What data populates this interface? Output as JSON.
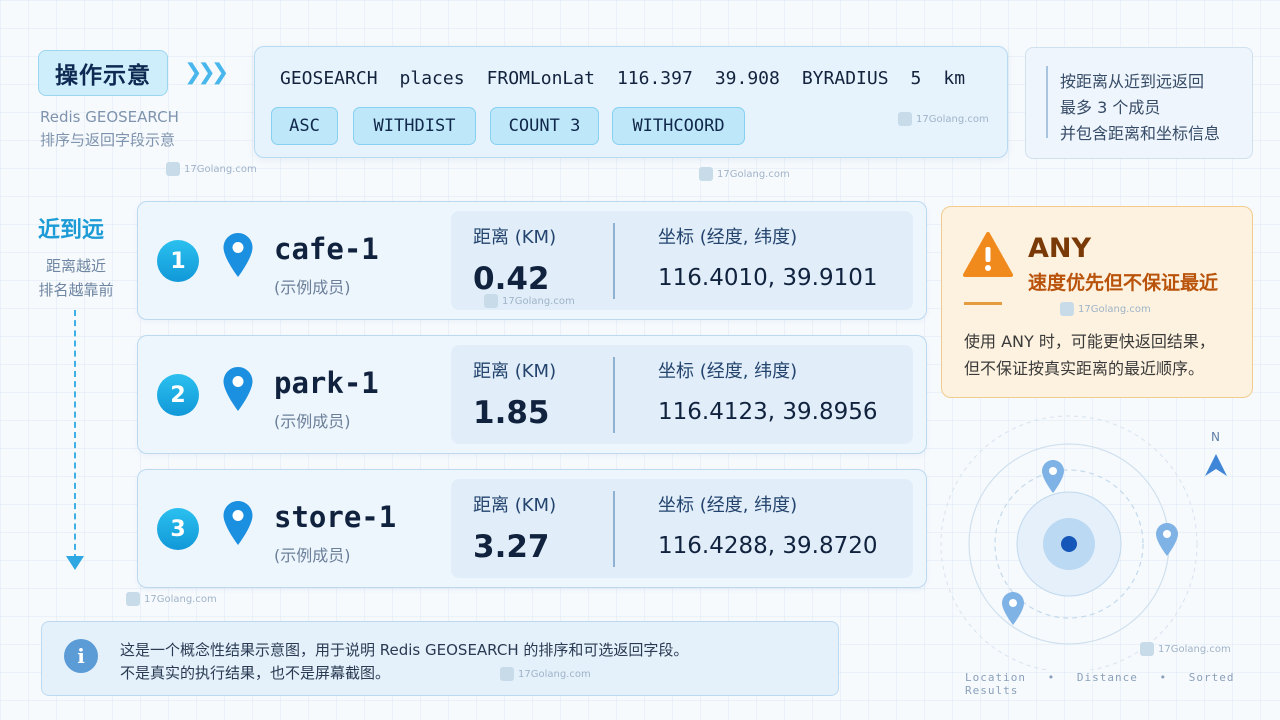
{
  "title": "操作示意",
  "subtitle": [
    "Redis GEOSEARCH",
    "排序与返回字段示意"
  ],
  "command": {
    "tokens": [
      "GEOSEARCH",
      "places",
      "FROMLonLat",
      "116.397",
      "39.908",
      "BYRADIUS",
      "5",
      "km"
    ],
    "options": [
      "ASC",
      "WITHDIST",
      "COUNT 3",
      "WITHCOORD"
    ]
  },
  "note": [
    "按距离从近到远返回",
    "最多 3 个成员",
    "并包含距离和坐标信息"
  ],
  "axis": {
    "title": "近到远",
    "desc": [
      "距离越近",
      "排名越靠前"
    ]
  },
  "results": [
    {
      "rank": "1",
      "member": "cafe-1",
      "sub": "(示例成员)",
      "dist_label": "距离 (KM)",
      "dist": "0.42",
      "coord_label": "坐标 (经度, 纬度)",
      "coord": "116.4010, 39.9101"
    },
    {
      "rank": "2",
      "member": "park-1",
      "sub": "(示例成员)",
      "dist_label": "距离 (KM)",
      "dist": "1.85",
      "coord_label": "坐标 (经度, 纬度)",
      "coord": "116.4123, 39.8956"
    },
    {
      "rank": "3",
      "member": "store-1",
      "sub": "(示例成员)",
      "dist_label": "距离 (KM)",
      "dist": "3.27",
      "coord_label": "坐标 (经度, 纬度)",
      "coord": "116.4288, 39.8720"
    }
  ],
  "warning": {
    "title": "ANY",
    "subtitle": "速度优先但不保证最近",
    "text": [
      "使用 ANY 时，可能更快返回结果，",
      "但不保证按真实距离的最近顺序。"
    ]
  },
  "map": {
    "north": "N",
    "legend": [
      "Location",
      "Distance",
      "Sorted Results"
    ]
  },
  "footer": [
    "这是一个概念性结果示意图，用于说明 Redis GEOSEARCH 的排序和可选返回字段。",
    "不是真实的执行结果，也不是屏幕截图。"
  ],
  "watermark": "17Golang.com",
  "colors": {
    "accent": "#1c9bd6",
    "warning": "#b9530b",
    "pin": "#1b8fe0"
  }
}
